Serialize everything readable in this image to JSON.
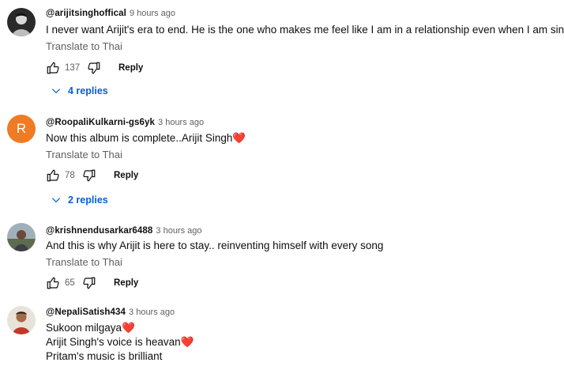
{
  "comments": [
    {
      "author": "@arijitsinghoffical",
      "time": "9 hours ago",
      "lines": [
        "I never want Arijit's era to end. He is the one who makes me feel like I am in a relationship even when I am single."
      ],
      "translate": "Translate to Thai",
      "likes": "137",
      "reply_label": "Reply",
      "replies_label": "4 replies"
    },
    {
      "author": "@RoopaliKulkarni-gs6yk",
      "time": "3 hours ago",
      "avatar_letter": "R",
      "lines": [
        "Now this album is complete..Arijit Singh"
      ],
      "line_hearts": [
        "❤️"
      ],
      "translate": "Translate to Thai",
      "likes": "78",
      "reply_label": "Reply",
      "replies_label": "2 replies"
    },
    {
      "author": "@krishnendusarkar6488",
      "time": "3 hours ago",
      "lines": [
        "And this is why Arijit is here to stay.. reinventing himself with every song"
      ],
      "translate": "Translate to Thai",
      "likes": "65",
      "reply_label": "Reply"
    },
    {
      "author": "@NepaliSatish434",
      "time": "3 hours ago",
      "lines": [
        "Sukoon milgaya",
        "Arijit Singh's voice is heavan",
        "Pritam's music is brilliant"
      ],
      "line_hearts": [
        "❤️",
        "❤️",
        ""
      ]
    }
  ],
  "colors": {
    "link": "#065fd4",
    "secondary": "#606060",
    "avatar_r": "#ef7b24",
    "heart": "#e0245e"
  },
  "icons": [
    "like-icon",
    "dislike-icon",
    "chevron-down-icon"
  ]
}
